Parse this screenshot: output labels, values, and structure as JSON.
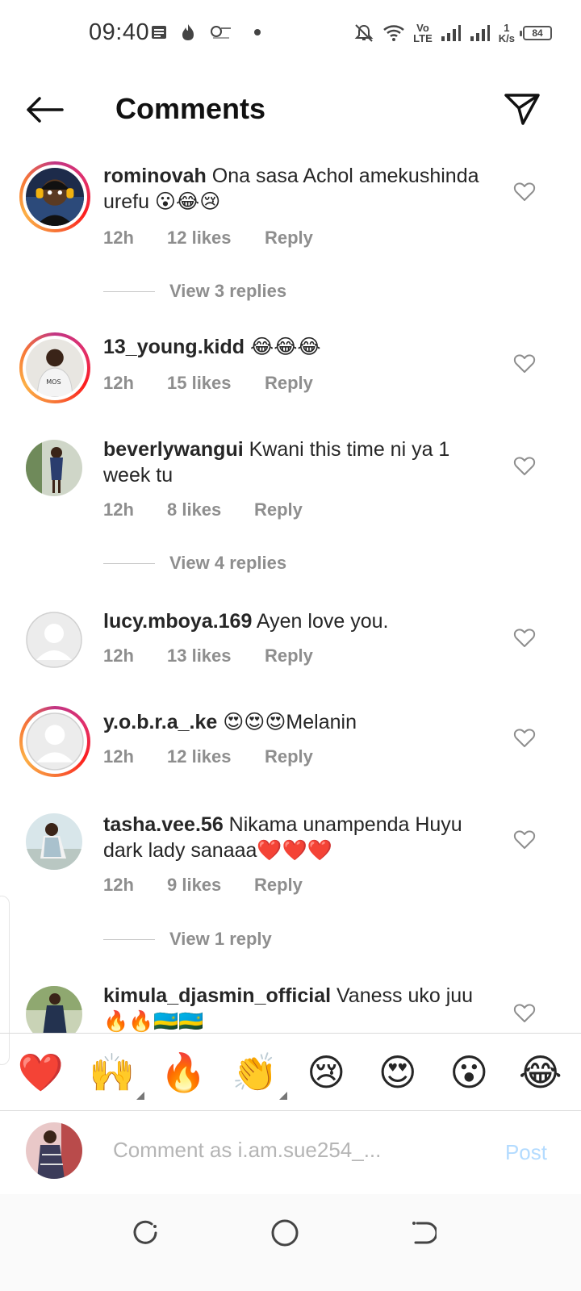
{
  "status_bar": {
    "time": "09:40",
    "network_label": "Vo\nLTE",
    "speed_value": "1",
    "speed_unit": "K/s",
    "battery": "84",
    "icons": [
      "notes-icon",
      "flame-app-icon",
      "safaricom-icon",
      "dot-icon",
      "mute-icon",
      "wifi-icon",
      "signal-icon",
      "signal-icon-2",
      "battery-icon"
    ]
  },
  "header": {
    "title": "Comments",
    "back_icon": "arrow-left-icon",
    "send_icon": "paper-plane-icon"
  },
  "comments": [
    {
      "username": "rominovah",
      "text": " Ona sasa Achol amekushinda urefu 😮😂😢",
      "time": "12h",
      "likes": "12 likes",
      "reply": "Reply",
      "view_replies": "View 3 replies",
      "story_ring": true
    },
    {
      "username": "13_young.kidd",
      "text": " 😂😂😂",
      "time": "12h",
      "likes": "15 likes",
      "reply": "Reply",
      "story_ring": true
    },
    {
      "username": "beverlywangui",
      "text": " Kwani this time ni ya 1 week tu",
      "time": "12h",
      "likes": "8 likes",
      "reply": "Reply",
      "view_replies": "View 4 replies",
      "story_ring": false
    },
    {
      "username": "lucy.mboya.169",
      "text": " Ayen love you.",
      "time": "12h",
      "likes": "13 likes",
      "reply": "Reply",
      "story_ring": false
    },
    {
      "username": "y.o.b.r.a_.ke",
      "text": " 😍😍😍Melanin",
      "time": "12h",
      "likes": "12 likes",
      "reply": "Reply",
      "story_ring": true
    },
    {
      "username": "tasha.vee.56",
      "text": " Nikama unampenda Huyu dark lady sanaaa❤️❤️❤️",
      "time": "12h",
      "likes": "9 likes",
      "reply": "Reply",
      "view_replies": "View 1 reply",
      "story_ring": false
    },
    {
      "username": "kimula_djasmin_official",
      "text": " Vaness uko juu 🔥🔥🇷🇼🇷🇼",
      "story_ring": false
    }
  ],
  "emoji_bar": [
    "❤️",
    "🙌",
    "🔥",
    "👏",
    "😢",
    "😍",
    "😮",
    "😂"
  ],
  "composer": {
    "placeholder": "Comment as i.am.sue254_...",
    "post_label": "Post"
  },
  "nav_bar": {
    "icons": [
      "recent-apps-icon",
      "home-icon",
      "back-nav-icon"
    ]
  },
  "colors": {
    "text": "#262626",
    "secondary": "#8e8e8e",
    "post_disabled": "#b3dbff",
    "story_ring_start": "#c13584",
    "story_ring_end": "#fcaf45"
  }
}
